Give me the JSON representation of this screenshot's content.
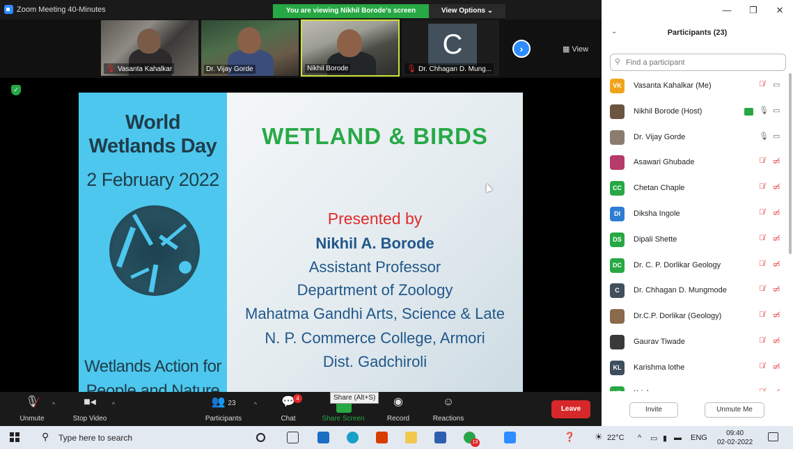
{
  "window": {
    "title": "Zoom Meeting 40-Minutes"
  },
  "banner": {
    "viewing": "You are viewing Nikhil Borode's screen",
    "view_options": "View Options ⌄"
  },
  "thumbnails": [
    {
      "name": "Vasanta Kahalkar",
      "muted": true
    },
    {
      "name": "Dr. Vijay Gorde",
      "muted": false
    },
    {
      "name": "Nikhil Borode",
      "muted": false
    },
    {
      "name": "Dr. Chhagan D. Mung...",
      "muted": true,
      "initial": "C"
    }
  ],
  "view_button": "View",
  "slide": {
    "left_title_1": "World",
    "left_title_2": "Wetlands Day",
    "left_date": "2 February 2022",
    "left_footer_1": "Wetlands Action for",
    "left_footer_2": "People and Nature",
    "title": "WETLAND & BIRDS",
    "presented_by": "Presented by",
    "presenter": "Nikhil A. Borode",
    "position": "Assistant Professor",
    "department": "Department of Zoology",
    "college_1": "Mahatma Gandhi Arts, Science & Late",
    "college_2": "N. P. Commerce College, Armori",
    "district": "Dist. Gadchiroli"
  },
  "toolbar": {
    "unmute": "Unmute",
    "stop_video": "Stop Video",
    "participants": "Participants",
    "participants_count": "23",
    "chat": "Chat",
    "chat_badge": "4",
    "share_screen": "Share Screen",
    "share_tooltip": "Share (Alt+S)",
    "record": "Record",
    "reactions": "Reactions",
    "leave": "Leave"
  },
  "panel": {
    "title": "Participants (23)",
    "search_placeholder": "Find a participant",
    "participants": [
      {
        "name": "Vasanta Kahalkar (Me)",
        "initials": "VK",
        "color": "#f0a41b"
      },
      {
        "name": "Nikhil Borode (Host)",
        "initials": "",
        "color": "#6b5540"
      },
      {
        "name": "Dr. Vijay Gorde",
        "initials": "",
        "color": "#8a7d70"
      },
      {
        "name": "Asawari Ghubade",
        "initials": "",
        "color": "#b53b6a"
      },
      {
        "name": "Chetan Chaple",
        "initials": "CC",
        "color": "#27a844"
      },
      {
        "name": "Diksha Ingole",
        "initials": "DI",
        "color": "#2d7dd2"
      },
      {
        "name": "Dipali Shette",
        "initials": "DS",
        "color": "#27a844"
      },
      {
        "name": "Dr. C. P. Dorlikar Geology",
        "initials": "DC",
        "color": "#27a844"
      },
      {
        "name": "Dr. Chhagan D. Mungmode",
        "initials": "C",
        "color": "#42505c"
      },
      {
        "name": "Dr.C.P. Dorlikar (Geology)",
        "initials": "",
        "color": "#8a6a4a"
      },
      {
        "name": "Gaurav Tiwade",
        "initials": "",
        "color": "#3a3a3a"
      },
      {
        "name": "Karishma lothe",
        "initials": "KL",
        "color": "#3e4e5e"
      },
      {
        "name": "Krishna...",
        "initials": "KP",
        "color": "#27a844"
      }
    ],
    "invite": "Invite",
    "unmute_me": "Unmute Me"
  },
  "taskbar": {
    "search_placeholder": "Type here to search",
    "badge": "13",
    "temp": "22°C",
    "lang": "ENG",
    "time": "09:40",
    "date": "02-02-2022"
  },
  "colors": {
    "accent": "#2d8cff",
    "green": "#27a844",
    "red": "#e02828",
    "slide_blue": "#4dc7ee"
  }
}
